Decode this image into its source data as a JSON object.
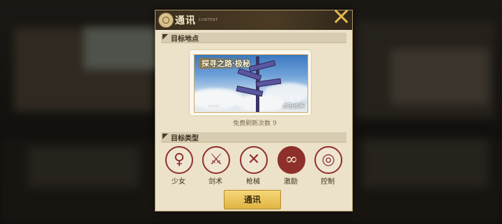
{
  "dialog": {
    "title": "通讯",
    "subtitle": "CONTENT"
  },
  "sections": {
    "target_location": "目标地点",
    "target_type": "目标类型"
  },
  "stamp": {
    "title": "探寻之路·极秘",
    "description": "·······",
    "refresh_label": "点击刷新"
  },
  "free_refresh": {
    "label": "免费刷新次数",
    "count": "9"
  },
  "types": [
    {
      "label": "少女",
      "icon": "girl-silhouette-icon",
      "active": false
    },
    {
      "label": "剑术",
      "icon": "swords-icon",
      "active": false
    },
    {
      "label": "枪械",
      "icon": "crossed-guns-icon",
      "active": false
    },
    {
      "label": "激励",
      "icon": "infinity-icon",
      "active": true
    },
    {
      "label": "控制",
      "icon": "spiral-icon",
      "active": false
    }
  ],
  "main_button": "通讯",
  "colors": {
    "accent": "#8e2f2c",
    "button_gold": "#e0b443",
    "panel": "#ece2c9"
  }
}
